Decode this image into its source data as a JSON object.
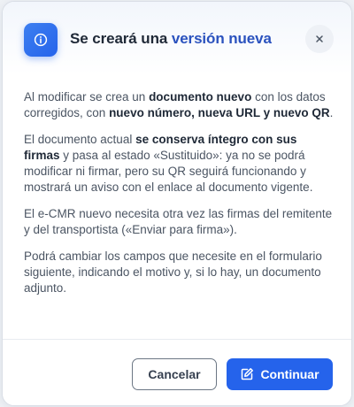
{
  "dialog": {
    "title_prefix": "Se creará una ",
    "title_accent": "versión nueva",
    "header_icon": "info-icon",
    "close_icon": "close-icon",
    "paragraphs": [
      [
        {
          "t": "Al modificar se crea un ",
          "b": false
        },
        {
          "t": "documento nuevo",
          "b": true
        },
        {
          "t": " con los datos corregidos, con ",
          "b": false
        },
        {
          "t": "nuevo número, nueva URL y nuevo QR",
          "b": true
        },
        {
          "t": ".",
          "b": false
        }
      ],
      [
        {
          "t": "El documento actual ",
          "b": false
        },
        {
          "t": "se conserva íntegro con sus firmas",
          "b": true
        },
        {
          "t": " y pasa al estado «Sustituido»: ya no se podrá modificar ni firmar, pero su QR seguirá funcionando y mostrará un aviso con el enlace al documento vigente.",
          "b": false
        }
      ],
      [
        {
          "t": "El e-CMR nuevo necesita otra vez las firmas del remitente y del transportista («Enviar para firma»).",
          "b": false
        }
      ],
      [
        {
          "t": "Podrá cambiar los campos que necesite en el formulario siguiente, indicando el motivo y, si lo hay, un documento adjunto.",
          "b": false
        }
      ]
    ],
    "buttons": {
      "cancel_label": "Cancelar",
      "continue_label": "Continuar",
      "continue_icon": "edit-icon"
    }
  },
  "colors": {
    "primary": "#2563eb",
    "title_accent": "#2a52be",
    "text": "#4b5563",
    "text_strong": "#1f2937"
  }
}
